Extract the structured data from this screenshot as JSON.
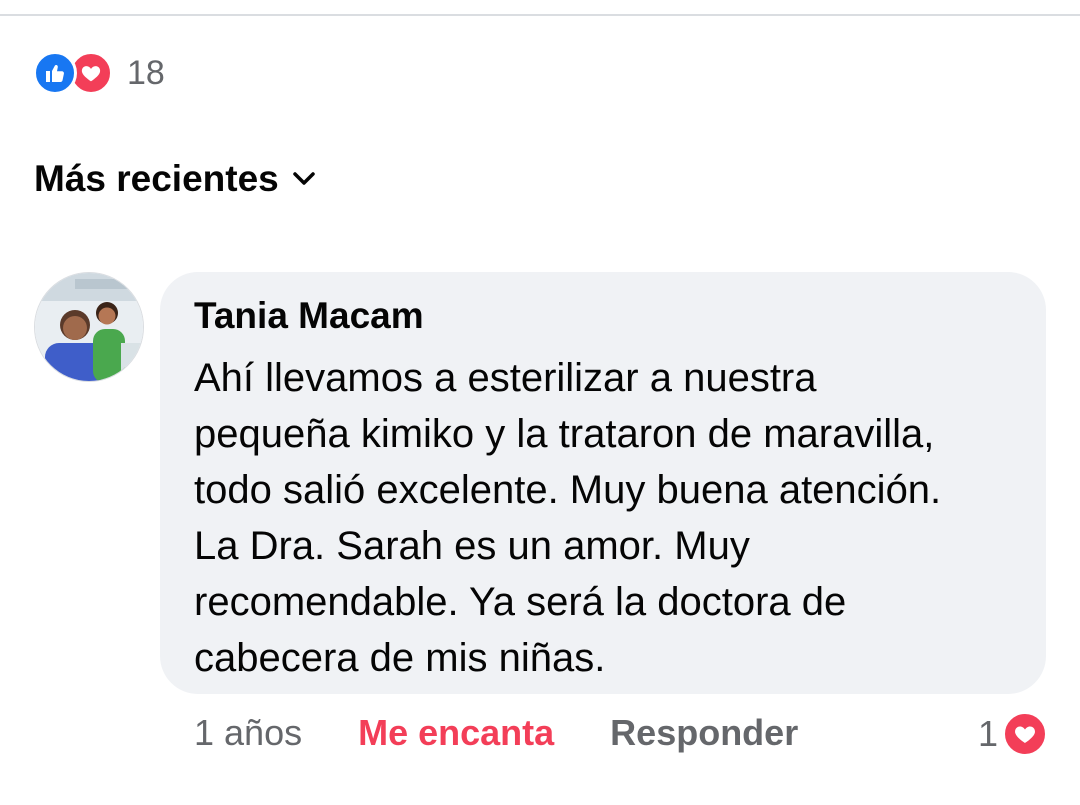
{
  "reactions_summary": {
    "count": "18",
    "icons": [
      "like-icon",
      "love-icon"
    ],
    "colors": {
      "like": "#1877f2",
      "love": "#f33e58"
    }
  },
  "sort": {
    "label": "Más recientes",
    "icon": "chevron-down-icon"
  },
  "comment": {
    "author": "Tania Macam",
    "text": "Ahí llevamos a esterilizar a nuestra\npequeña kimiko y la trataron de maravilla,\ntodo salió excelente. Muy buena atención.\nLa Dra. Sarah es un amor. Muy\nrecomendable. Ya será la doctora de\ncabecera de mis niñas.",
    "timestamp": "1 años",
    "react_label": "Me encanta",
    "reply_label": "Responder",
    "reaction_count": "1",
    "reaction_icon": "love-icon",
    "colors": {
      "react_active": "#f33e58",
      "bubble": "#f0f2f5",
      "muted_text": "#65676b"
    }
  }
}
